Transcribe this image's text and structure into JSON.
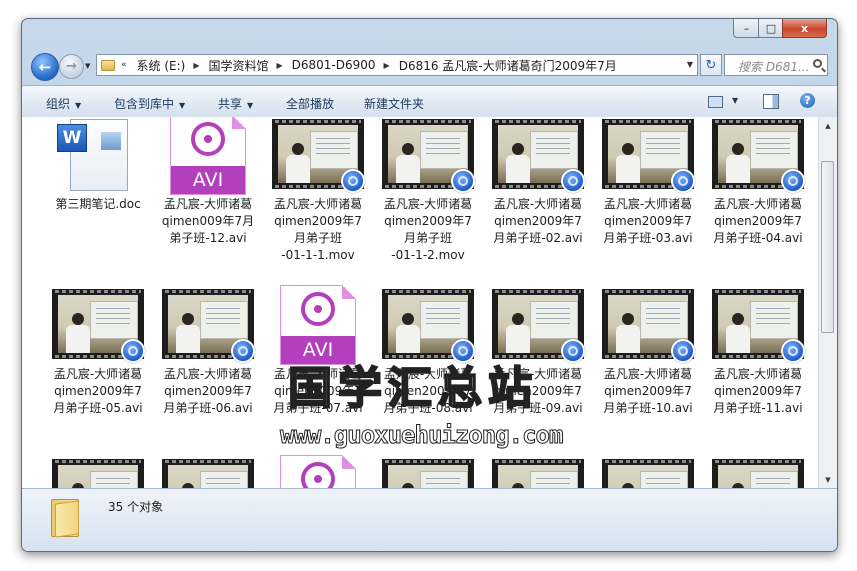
{
  "window_controls": {
    "minimize": "–",
    "maximize": "□",
    "close": "x"
  },
  "nav": {
    "back_glyph": "←",
    "forward_glyph": "→"
  },
  "address": {
    "lead": "«",
    "crumbs": [
      "系统 (E:)",
      "国学资料馆",
      "D6801-D6900",
      "D6816 孟凡宸-大师诸葛奇门2009年7月"
    ],
    "separator": "▶"
  },
  "search": {
    "placeholder": "搜索 D681..."
  },
  "toolbar": {
    "organize": "组织",
    "include_library": "包含到库中",
    "share": "共享",
    "play_all": "全部播放",
    "new_folder": "新建文件夹",
    "dropdown_glyph": "▼",
    "help_glyph": "?"
  },
  "files": [
    {
      "type": "doc",
      "lines": [
        "第三期笔记.doc"
      ]
    },
    {
      "type": "avi",
      "lines": [
        "孟凡宸-大师诸葛",
        "qimen009年7月",
        "弟子班-12.avi"
      ]
    },
    {
      "type": "video",
      "lines": [
        "孟凡宸-大师诸葛",
        "qimen2009年7",
        "月弟子班",
        "-01-1-1.mov"
      ]
    },
    {
      "type": "video",
      "lines": [
        "孟凡宸-大师诸葛",
        "qimen2009年7",
        "月弟子班",
        "-01-1-2.mov"
      ]
    },
    {
      "type": "video",
      "lines": [
        "孟凡宸-大师诸葛",
        "qimen2009年7",
        "月弟子班-02.avi"
      ]
    },
    {
      "type": "video",
      "lines": [
        "孟凡宸-大师诸葛",
        "qimen2009年7",
        "月弟子班-03.avi"
      ]
    },
    {
      "type": "video",
      "lines": [
        "孟凡宸-大师诸葛",
        "qimen2009年7",
        "月弟子班-04.avi"
      ]
    },
    {
      "type": "video",
      "lines": [
        "孟凡宸-大师诸葛",
        "qimen2009年7",
        "月弟子班-05.avi"
      ]
    },
    {
      "type": "video",
      "lines": [
        "孟凡宸-大师诸葛",
        "qimen2009年7",
        "月弟子班-06.avi"
      ]
    },
    {
      "type": "avi",
      "lines": [
        "孟凡宸-大师诸葛",
        "qimen2009年7",
        "月弟子班-07.avi"
      ]
    },
    {
      "type": "video",
      "lines": [
        "孟凡宸-大师诸葛",
        "qimen2009年7",
        "月弟子班-08.avi"
      ]
    },
    {
      "type": "video",
      "lines": [
        "孟凡宸-大师诸葛",
        "qimen2009年7",
        "月弟子班-09.avi"
      ]
    },
    {
      "type": "video",
      "lines": [
        "孟凡宸-大师诸葛",
        "qimen2009年7",
        "月弟子班-10.avi"
      ]
    },
    {
      "type": "video",
      "lines": [
        "孟凡宸-大师诸葛",
        "qimen2009年7",
        "月弟子班-11.avi"
      ]
    },
    {
      "type": "video",
      "lines": []
    },
    {
      "type": "video",
      "lines": []
    },
    {
      "type": "avi",
      "lines": []
    },
    {
      "type": "video",
      "lines": []
    },
    {
      "type": "video",
      "lines": []
    },
    {
      "type": "video",
      "lines": []
    },
    {
      "type": "video",
      "lines": []
    }
  ],
  "avi_badge": "AVI",
  "word_badge": "W",
  "watermark": {
    "chinese": "国学汇总站",
    "url": "www.guoxuehuizong.com"
  },
  "status": {
    "object_count": "35 个对象"
  },
  "scrollbar": {
    "up_glyph": "▲",
    "down_glyph": "▼"
  }
}
